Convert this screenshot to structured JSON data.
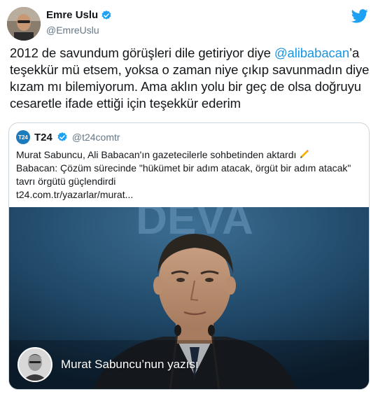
{
  "author": {
    "name": "Emre Uslu",
    "handle": "@EmreUslu",
    "avatar_icon": "user-avatar"
  },
  "tweet": {
    "text_before": "2012 de savundum görüşleri dile getiriyor diye ",
    "mention": "@alibabacan",
    "text_after": "’a teşekkür mü etsem, yoksa o zaman niye çıkıp savunmadın diye kızam mı bilemiyorum. Ama aklın yolu bir geç de olsa doğruyu cesaretle ifade ettiği için teşekkür ederim"
  },
  "quote": {
    "avatar_label": "T24",
    "name": "T24",
    "handle": "@t24comtr",
    "line1": "Murat Sabuncu, Ali Babacan'ın gazetecilerle sohbetinden aktardı",
    "line2": "Babacan: Çözüm sürecinde \"hükümet bir adım atacak, örgüt bir adım atacak\" tavrı örgütü güçlendirdi",
    "link": "t24.com.tr/yazarlar/murat...",
    "image_banner": "DEVA",
    "byline": "Murat Sabuncu’nun yazısı"
  },
  "colors": {
    "link": "#1b95e0",
    "verified": "#1da1f2",
    "twitter_blue": "#1da1f2",
    "border": "#ccd6dd",
    "secondary_text": "#657786"
  }
}
